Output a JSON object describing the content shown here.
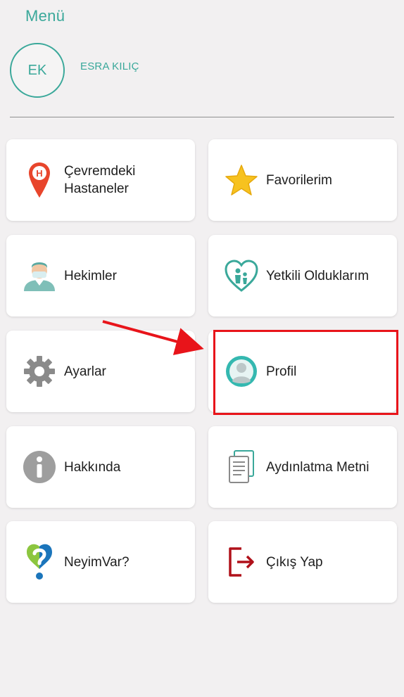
{
  "menu": {
    "title": "Menü"
  },
  "user": {
    "initials": "EK",
    "name": "ESRA KILIÇ"
  },
  "items": [
    {
      "label": "Çevremdeki Hastaneler",
      "icon": "hospital-pin-icon"
    },
    {
      "label": "Favorilerim",
      "icon": "star-icon"
    },
    {
      "label": "Hekimler",
      "icon": "doctor-icon"
    },
    {
      "label": "Yetkili Olduklarım",
      "icon": "family-heart-icon"
    },
    {
      "label": "Ayarlar",
      "icon": "gear-icon"
    },
    {
      "label": "Profil",
      "icon": "profile-icon"
    },
    {
      "label": "Hakkında",
      "icon": "info-icon"
    },
    {
      "label": "Aydınlatma Metni",
      "icon": "document-icon"
    },
    {
      "label": "NeyimVar?",
      "icon": "question-heart-icon"
    },
    {
      "label": "Çıkış Yap",
      "icon": "logout-icon"
    }
  ],
  "colors": {
    "accent": "#3aa89a",
    "highlight": "#e8141a",
    "background": "#f2f0f1"
  }
}
